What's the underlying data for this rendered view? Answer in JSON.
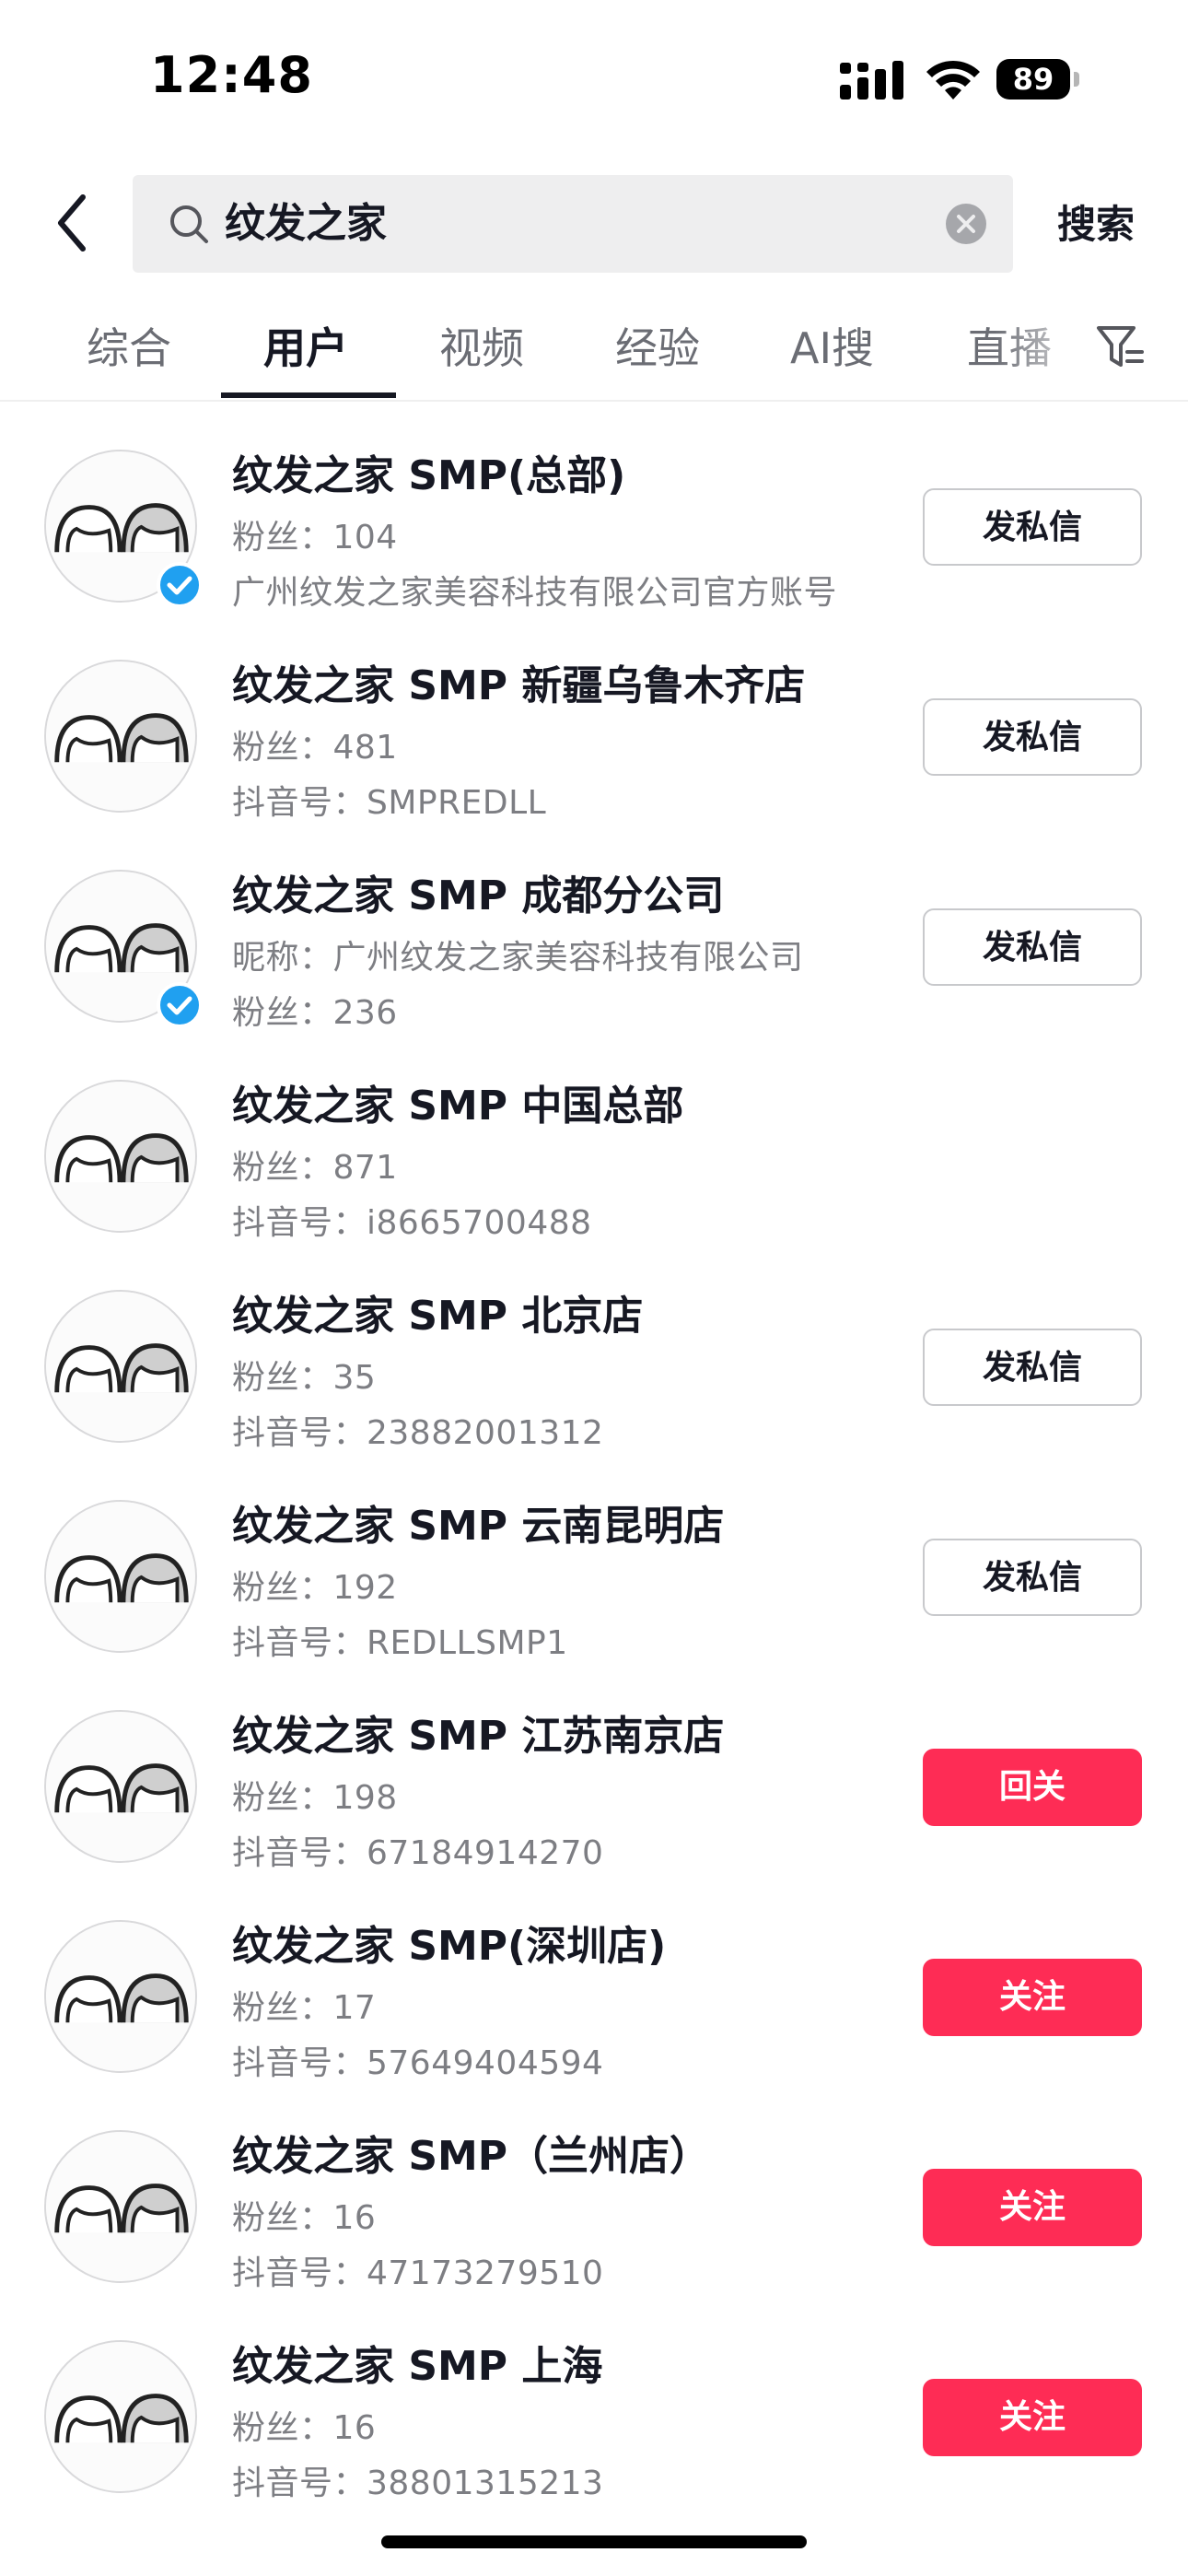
{
  "status_bar": {
    "time": "12:48",
    "battery": "89"
  },
  "search": {
    "query": "纹发之家",
    "button_label": "搜索"
  },
  "tabs": [
    {
      "label": "综合",
      "active": false
    },
    {
      "label": "用户",
      "active": true
    },
    {
      "label": "视频",
      "active": false
    },
    {
      "label": "经验",
      "active": false
    },
    {
      "label": "AI搜",
      "active": false
    },
    {
      "label": "直播",
      "active": false
    }
  ],
  "users": [
    {
      "name": "纹发之家 SMP(总部)",
      "line1": "粉丝：104",
      "line2": "广州纹发之家美容科技有限公司官方账号",
      "verified": true,
      "action": "发私信",
      "action_style": "outline"
    },
    {
      "name": "纹发之家 SMP 新疆乌鲁木齐店",
      "line1": "粉丝：481",
      "line2": "抖音号：SMPREDLL",
      "verified": false,
      "action": "发私信",
      "action_style": "outline"
    },
    {
      "name": "纹发之家 SMP 成都分公司",
      "line1": "昵称：广州纹发之家美容科技有限公司",
      "line2": "粉丝：236",
      "verified": true,
      "action": "发私信",
      "action_style": "outline"
    },
    {
      "name": "纹发之家 SMP 中国总部",
      "line1": "粉丝：871",
      "line2": "抖音号：i8665700488",
      "verified": false,
      "action": "",
      "action_style": "none"
    },
    {
      "name": "纹发之家 SMP 北京店",
      "line1": "粉丝：35",
      "line2": "抖音号：23882001312",
      "verified": false,
      "action": "发私信",
      "action_style": "outline"
    },
    {
      "name": "纹发之家 SMP 云南昆明店",
      "line1": "粉丝：192",
      "line2": "抖音号：REDLLSMP1",
      "verified": false,
      "action": "发私信",
      "action_style": "outline"
    },
    {
      "name": "纹发之家 SMP 江苏南京店",
      "line1": "粉丝：198",
      "line2": "抖音号：67184914270",
      "verified": false,
      "action": "回关",
      "action_style": "primary"
    },
    {
      "name": "纹发之家 SMP(深圳店)",
      "line1": "粉丝：17",
      "line2": "抖音号：57649404594",
      "verified": false,
      "action": "关注",
      "action_style": "primary"
    },
    {
      "name": "纹发之家 SMP（兰州店）",
      "line1": "粉丝：16",
      "line2": "抖音号：47173279510",
      "verified": false,
      "action": "关注",
      "action_style": "primary"
    },
    {
      "name": "纹发之家 SMP 上海",
      "line1": "粉丝：16",
      "line2": "抖音号：38801315213",
      "verified": false,
      "action": "关注",
      "action_style": "primary"
    }
  ],
  "colors": {
    "accent": "#fe2c55",
    "verified": "#20a0f0",
    "text_primary": "#161823",
    "text_secondary": "#7d7e83"
  }
}
